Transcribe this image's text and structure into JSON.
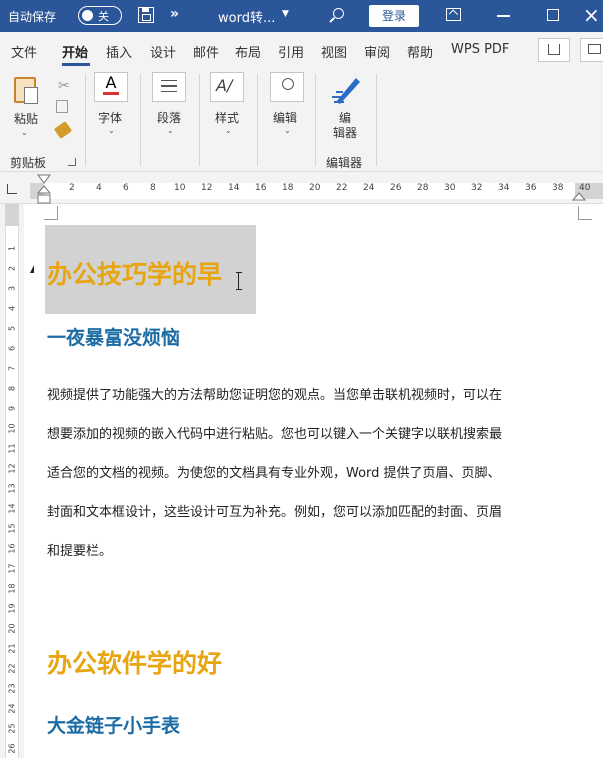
{
  "titlebar": {
    "autosave_label": "自动保存",
    "autosave_state": "关",
    "more_glyph": "»",
    "doc_title": "word转...",
    "login_label": "登录"
  },
  "tabs": [
    "文件",
    "开始",
    "插入",
    "设计",
    "邮件",
    "布局",
    "引用",
    "视图",
    "审阅",
    "帮助",
    "WPS PDF"
  ],
  "active_tab": "开始",
  "ribbon": {
    "paste_label": "粘贴",
    "clipboard_group": "剪贴板",
    "font_label": "字体",
    "paragraph_label": "段落",
    "styles_label": "样式",
    "editing_label": "编辑",
    "editor_label": "编\n辑器",
    "editor_group": "编辑器"
  },
  "ruler": {
    "numbers": [
      "2",
      "4",
      "6",
      "8",
      "10",
      "12",
      "14",
      "16",
      "18",
      "20",
      "22",
      "24",
      "26",
      "28",
      "30",
      "32",
      "34",
      "36",
      "38",
      "40"
    ]
  },
  "vruler": {
    "numbers": [
      "1",
      "2",
      "3",
      "4",
      "5",
      "6",
      "7",
      "8",
      "9",
      "10",
      "11",
      "12",
      "13",
      "14",
      "15",
      "16",
      "17",
      "18",
      "19",
      "20",
      "21",
      "22",
      "23",
      "24",
      "25",
      "26"
    ]
  },
  "document": {
    "heading1": "办公技巧学的早",
    "heading2": "一夜暴富没烦恼",
    "body_lines": [
      "视频提供了功能强大的方法帮助您证明您的观点。当您单击联机视频时，可以在",
      "想要添加的视频的嵌入代码中进行粘贴。您也可以键入一个关键字以联机搜索最",
      "适合您的文档的视频。为使您的文档具有专业外观，Word  提供了页眉、页脚、",
      "封面和文本框设计，这些设计可互为补充。例如，您可以添加匹配的封面、页眉",
      "和提要栏。"
    ],
    "heading3": "办公软件学的好",
    "heading4": "大金链子小手表"
  }
}
